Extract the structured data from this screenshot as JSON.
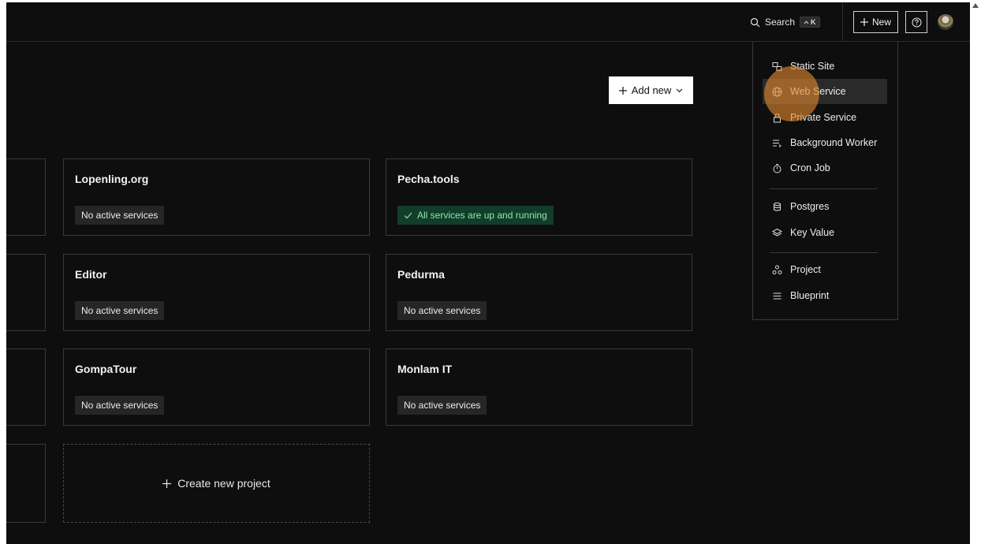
{
  "topbar": {
    "search_label": "Search",
    "search_kbd": "K",
    "new_label": "New"
  },
  "add_new_label": "Add new",
  "projects": [
    {
      "name": "Lopenling.org",
      "status": "No active services",
      "ok": false
    },
    {
      "name": "Pecha.tools",
      "status": "All services are up and running",
      "ok": true
    },
    {
      "name": "Editor",
      "status": "No active services",
      "ok": false
    },
    {
      "name": "Pedurma",
      "status": "No active services",
      "ok": false
    },
    {
      "name": "GompaTour",
      "status": "No active services",
      "ok": false
    },
    {
      "name": "Monlam IT",
      "status": "No active services",
      "ok": false
    }
  ],
  "create_project_label": "Create new project",
  "new_menu": {
    "items": [
      {
        "label": "Static Site",
        "icon": "static-site-icon"
      },
      {
        "label": "Web Service",
        "icon": "globe-icon",
        "active": true
      },
      {
        "label": "Private Service",
        "icon": "lock-icon"
      },
      {
        "label": "Background Worker",
        "icon": "worker-icon"
      },
      {
        "label": "Cron Job",
        "icon": "timer-icon"
      },
      {
        "label": "Postgres",
        "icon": "database-icon"
      },
      {
        "label": "Key Value",
        "icon": "layers-icon"
      },
      {
        "label": "Project",
        "icon": "project-icon"
      },
      {
        "label": "Blueprint",
        "icon": "blueprint-icon"
      }
    ]
  },
  "colors": {
    "background": "#0e0e0e",
    "border": "#3a3a3a",
    "success_bg": "#113d2a",
    "success_text": "#8be8ad",
    "cursor_highlight": "#e1872d"
  }
}
